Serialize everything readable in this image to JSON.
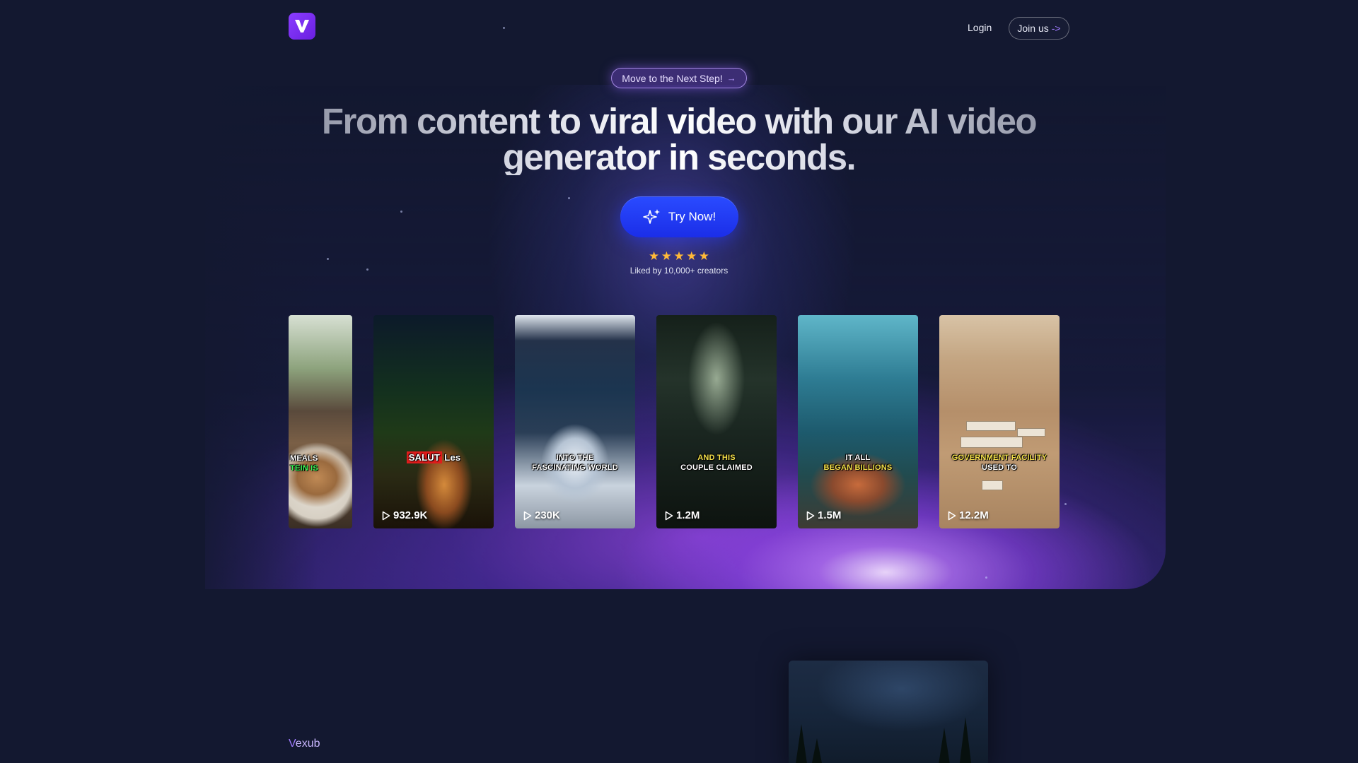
{
  "header": {
    "logo_letter": "V",
    "login_label": "Login",
    "join_label": "Join us",
    "join_arrow": "->"
  },
  "hero": {
    "pill_label": "Move to the Next Step!",
    "pill_arrow": "→",
    "headline_line1": "From content to viral video with our AI video",
    "headline_line2": "generator in seconds.",
    "cta_label": "Try Now!",
    "rating_stars": 5,
    "liked_text": "Liked by 10,000+ creators"
  },
  "videos": [
    {
      "caption_line1": "MEALS",
      "caption_line2": "TEIN IS",
      "views": ""
    },
    {
      "caption_line1": "SALUT",
      "caption_line2": "Les",
      "views": "932.9K"
    },
    {
      "caption_line1": "INTO THE",
      "caption_line2": "FASCINATING WORLD",
      "views": "230K"
    },
    {
      "caption_line1": "AND THIS",
      "caption_line2": "COUPLE CLAIMED",
      "views": "1.2M"
    },
    {
      "caption_line1": "IT ALL",
      "caption_line2": "BEGAN BILLIONS",
      "views": "1.5M"
    },
    {
      "caption_line1": "GOVERNMENT FACILITY",
      "caption_line2": "USED TO",
      "views": "12.2M"
    }
  ],
  "section2": {
    "brand_label_prefix": "V",
    "brand_label_rest": "exub"
  },
  "colors": {
    "background": "#131830",
    "accent": "#8a3dff",
    "cta": "#1b2ee8",
    "star": "#ffb938"
  }
}
